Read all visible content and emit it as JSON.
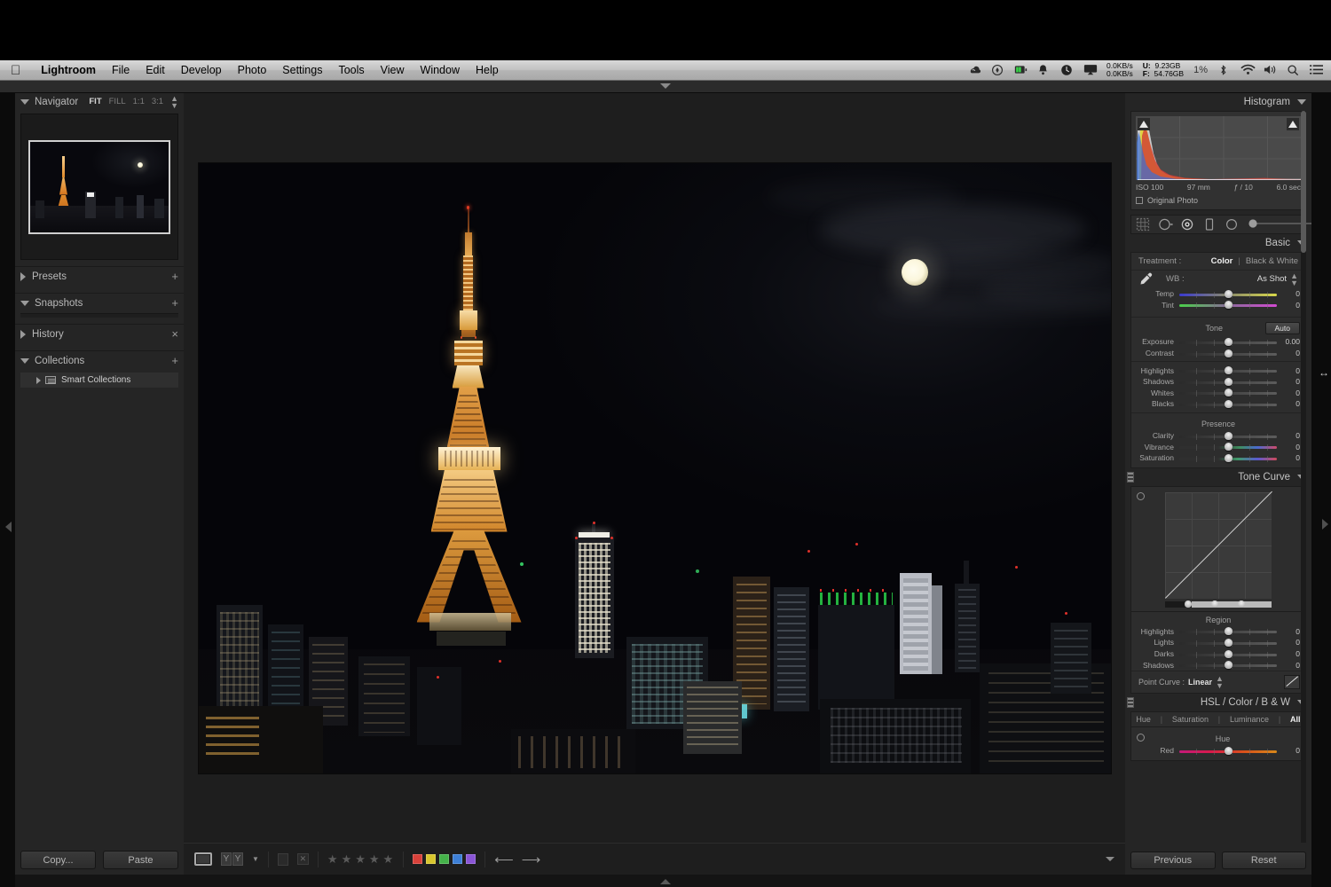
{
  "menubar": {
    "apple_icon": "apple-logo-icon",
    "items": [
      "Lightroom",
      "File",
      "Edit",
      "Develop",
      "Photo",
      "Settings",
      "Tools",
      "View",
      "Window",
      "Help"
    ],
    "status": {
      "icons": [
        "creative-cloud-icon",
        "shield-icon",
        "battery-icon",
        "bell-icon",
        "clock-icon",
        "airplay-icon"
      ],
      "net_up": "0.0KB/s",
      "net_down": "0.0KB/s",
      "used_label": "U:",
      "used_value": "9.23GB",
      "free_label": "F:",
      "free_value": "54.76GB",
      "cpu_percent": "1%",
      "right_icons": [
        "bluetooth-icon",
        "wifi-icon",
        "volume-icon",
        "search-icon",
        "notification-center-icon"
      ]
    }
  },
  "left_panel": {
    "navigator": {
      "title": "Navigator",
      "zoom_modes": [
        "FIT",
        "FILL",
        "1:1",
        "3:1"
      ],
      "active_zoom": "FIT"
    },
    "presets": {
      "title": "Presets",
      "add": "+"
    },
    "snapshots": {
      "title": "Snapshots",
      "add": "+"
    },
    "history": {
      "title": "History",
      "clear": "×"
    },
    "collections": {
      "title": "Collections",
      "add": "+"
    },
    "smart_collections": "Smart Collections",
    "copy_label": "Copy...",
    "paste_label": "Paste"
  },
  "toolbar": {
    "view_icon": "loupe-view-icon",
    "compare_icon": "before-after-icon",
    "dropdown_icon": "chevron-down-icon",
    "flag_icon": "flag-icon",
    "reject_icon": "reject-flag-icon",
    "stars": 5,
    "rating": 0,
    "color_labels": [
      "#d8413a",
      "#d8c62e",
      "#45b24a",
      "#3d7fd6",
      "#8a55d6"
    ],
    "prev_icon": "arrow-left-icon",
    "next_icon": "arrow-right-icon",
    "panel_caret": "chevron-down-icon"
  },
  "right_panel": {
    "histogram": {
      "title": "Histogram",
      "iso": "ISO 100",
      "focal": "97 mm",
      "aperture": "ƒ / 10",
      "shutter": "6.0 sec",
      "original_photo": "Original Photo"
    },
    "tools": [
      "crop-overlay-icon",
      "spot-removal-icon",
      "red-eye-icon",
      "graduated-filter-icon",
      "radial-filter-icon",
      "adjustment-brush-icon"
    ],
    "basic": {
      "title": "Basic",
      "treatment_label": "Treatment :",
      "treatment_options": [
        "Color",
        "Black & White"
      ],
      "treatment_active": "Color",
      "wb_label": "WB :",
      "wb_value": "As Shot",
      "eyedropper_icon": "white-balance-eyedropper-icon",
      "wb_sliders": [
        {
          "name": "Temp",
          "value": "0",
          "pos": 50,
          "grad": "linear-gradient(90deg,#3a3ad0,#8f8f6a,#d8d84a)"
        },
        {
          "name": "Tint",
          "value": "0",
          "pos": 50,
          "grad": "linear-gradient(90deg,#4ad04a,#8a6a9a,#d24ad2)"
        }
      ],
      "tone_label": "Tone",
      "auto_label": "Auto",
      "tone_sliders": [
        {
          "name": "Exposure",
          "value": "0.00",
          "pos": 50
        },
        {
          "name": "Contrast",
          "value": "0",
          "pos": 50
        }
      ],
      "tone_sliders2": [
        {
          "name": "Highlights",
          "value": "0",
          "pos": 50
        },
        {
          "name": "Shadows",
          "value": "0",
          "pos": 50
        },
        {
          "name": "Whites",
          "value": "0",
          "pos": 50
        },
        {
          "name": "Blacks",
          "value": "0",
          "pos": 50
        }
      ],
      "presence_label": "Presence",
      "presence_sliders": [
        {
          "name": "Clarity",
          "value": "0",
          "pos": 50,
          "grad": ""
        },
        {
          "name": "Vibrance",
          "value": "0",
          "pos": 50,
          "grad": "linear-gradient(90deg,#2a2a2a 45%,#4aa04a 60%,#4a6ad0 75%,#d04a6a 100%)"
        },
        {
          "name": "Saturation",
          "value": "0",
          "pos": 50,
          "grad": "linear-gradient(90deg,#2a2a2a 45%,#4a9a6a 60%,#5a5ad0 78%,#d04a5a 100%)"
        }
      ]
    },
    "tone_curve": {
      "title": "Tone Curve",
      "region_label": "Region",
      "sliders": [
        {
          "name": "Highlights",
          "value": "0",
          "pos": 50
        },
        {
          "name": "Lights",
          "value": "0",
          "pos": 50
        },
        {
          "name": "Darks",
          "value": "0",
          "pos": 50
        },
        {
          "name": "Shadows",
          "value": "0",
          "pos": 50
        }
      ],
      "point_curve_label": "Point Curve :",
      "point_curve_value": "Linear",
      "edit_icon": "edit-point-curve-icon",
      "split_positions": [
        22,
        47,
        72
      ]
    },
    "hsl": {
      "title": "HSL / Color / B & W",
      "tabs": [
        "Hue",
        "Saturation",
        "Luminance",
        "All"
      ],
      "active_tab": "All",
      "sub_label": "Hue",
      "sliders": [
        {
          "name": "Red",
          "value": "0",
          "pos": 50,
          "grad": "linear-gradient(90deg,#c41a7a,#d81a4a,#d8521a,#d8881a)"
        }
      ]
    },
    "previous_label": "Previous",
    "reset_label": "Reset"
  },
  "photo": {
    "title": "Tokyo Tower at night skyline",
    "alt": "night cityscape with illuminated orange tower and full moon"
  },
  "colors": {
    "panel_bg": "#252525",
    "sub_bg": "#2d2d2d",
    "text": "#a8a8a8",
    "highlight": "#efefef",
    "tower_orange": "#e0892a"
  }
}
